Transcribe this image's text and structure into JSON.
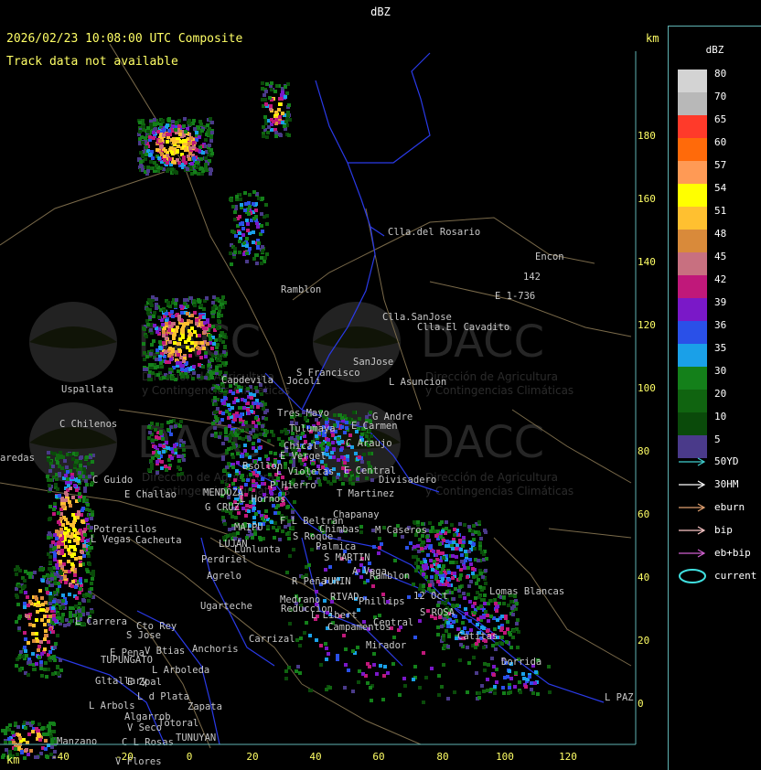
{
  "window": {
    "title": "dBZ"
  },
  "header": {
    "timestamp": "2026/02/23 10:08:00 UTC Composite",
    "track_status": "Track data not available",
    "unit_top_right": "km",
    "unit_bottom_left": "km"
  },
  "axes": {
    "y_ticks": [
      "180",
      "160",
      "140",
      "120",
      "100",
      "80",
      "60",
      "40",
      "20",
      "0"
    ],
    "x_ticks": [
      "-40",
      "-20",
      "0",
      "20",
      "40",
      "60",
      "80",
      "100",
      "120"
    ]
  },
  "watermark": {
    "brand": "DACC",
    "line1": "Dirección de Agricultura",
    "line2": "y Contingencias Climáticas"
  },
  "places": [
    {
      "name": "Clla.del Rosario"
    },
    {
      "name": "Encon"
    },
    {
      "name": "142"
    },
    {
      "name": "E 1-736"
    },
    {
      "name": "Ramblon"
    },
    {
      "name": "Clla.SanJose"
    },
    {
      "name": "Clla.El Cavadito"
    },
    {
      "name": "SanJose"
    },
    {
      "name": "S Francisco"
    },
    {
      "name": "L Asuncion"
    },
    {
      "name": "Uspallata"
    },
    {
      "name": "Capdevila"
    },
    {
      "name": "Jocoli"
    },
    {
      "name": "Tres Mayo"
    },
    {
      "name": "G Andre"
    },
    {
      "name": "E Carmen"
    },
    {
      "name": "C Chilenos"
    },
    {
      "name": "Tulumaya"
    },
    {
      "name": "C Araujo"
    },
    {
      "name": "Chical"
    },
    {
      "name": "E Vergel"
    },
    {
      "name": "L Violetas"
    },
    {
      "name": "E Central"
    },
    {
      "name": "Divisadero"
    },
    {
      "name": "aredas"
    },
    {
      "name": "C Guido"
    },
    {
      "name": "E Challao"
    },
    {
      "name": "Bsollon"
    },
    {
      "name": "P Hierro"
    },
    {
      "name": "MENDOZA"
    },
    {
      "name": "L Hornos"
    },
    {
      "name": "G CRUZ"
    },
    {
      "name": "T Martinez"
    },
    {
      "name": "Chapanay"
    },
    {
      "name": "F L Beltran"
    },
    {
      "name": "Chimbas"
    },
    {
      "name": "M Caseros"
    },
    {
      "name": "Potrerillos"
    },
    {
      "name": "L Vegas"
    },
    {
      "name": "Cacheuta"
    },
    {
      "name": "MAIPU"
    },
    {
      "name": "LUJAN"
    },
    {
      "name": "Lunlunta"
    },
    {
      "name": "S Roque"
    },
    {
      "name": "Palmica"
    },
    {
      "name": "Perdriel"
    },
    {
      "name": "S MARTIN"
    },
    {
      "name": "A Vega"
    },
    {
      "name": "Ramblon"
    },
    {
      "name": "Agrelo"
    },
    {
      "name": "R Peña"
    },
    {
      "name": "JUNIN"
    },
    {
      "name": "Lomas Blancas"
    },
    {
      "name": "Ugarteche"
    },
    {
      "name": "Medrano"
    },
    {
      "name": "RIVAD"
    },
    {
      "name": "Phillips"
    },
    {
      "name": "12 Oct"
    },
    {
      "name": "Reduccion"
    },
    {
      "name": "L Libert"
    },
    {
      "name": "S ROSA"
    },
    {
      "name": "L Carrera"
    },
    {
      "name": "Cto Rey"
    },
    {
      "name": "S Jose"
    },
    {
      "name": "Campamentos"
    },
    {
      "name": "Central"
    },
    {
      "name": "Catitas"
    },
    {
      "name": "Carrizal"
    },
    {
      "name": "E Pena"
    },
    {
      "name": "V Btias"
    },
    {
      "name": "Anchoris"
    },
    {
      "name": "Mirador"
    },
    {
      "name": "Dorrida"
    },
    {
      "name": "TUPUNGATO"
    },
    {
      "name": "L Arboleda"
    },
    {
      "name": "Gltallary"
    },
    {
      "name": "E Zpal"
    },
    {
      "name": "L d Plata"
    },
    {
      "name": "L Arbols"
    },
    {
      "name": "Zapata"
    },
    {
      "name": "L PAZ"
    },
    {
      "name": "Algarrob"
    },
    {
      "name": "V Seco"
    },
    {
      "name": "Totoral"
    },
    {
      "name": "TUNUYAN"
    },
    {
      "name": "Manzano"
    },
    {
      "name": "C L Rosas"
    },
    {
      "name": "V Flores"
    }
  ],
  "legend": {
    "title": "dBZ",
    "scale": [
      {
        "value": "80",
        "color": "#d3d3d3"
      },
      {
        "value": "70",
        "color": "#b8b8b8"
      },
      {
        "value": "65",
        "color": "#ff3a2a"
      },
      {
        "value": "60",
        "color": "#ff6a0a"
      },
      {
        "value": "57",
        "color": "#ff9a55"
      },
      {
        "value": "54",
        "color": "#ffff00"
      },
      {
        "value": "51",
        "color": "#ffc030"
      },
      {
        "value": "48",
        "color": "#d98a3a"
      },
      {
        "value": "45",
        "color": "#c87080"
      },
      {
        "value": "42",
        "color": "#c0187a"
      },
      {
        "value": "39",
        "color": "#7a18c8"
      },
      {
        "value": "36",
        "color": "#2a50e8"
      },
      {
        "value": "35",
        "color": "#1aa0e8"
      },
      {
        "value": "30",
        "color": "#14801a"
      },
      {
        "value": "20",
        "color": "#106410"
      },
      {
        "value": "10",
        "color": "#0a4a0a"
      },
      {
        "value": "5",
        "color": "#4a3a8a"
      }
    ],
    "tracks": [
      {
        "label": "50YD",
        "color": "#40d0d0",
        "kind": "arrow"
      },
      {
        "label": "30HM",
        "color": "#ffffff",
        "kind": "arrow"
      },
      {
        "label": "eburn",
        "color": "#e0a070",
        "kind": "arrow"
      },
      {
        "label": "bip",
        "color": "#ffc8c8",
        "kind": "arrow"
      },
      {
        "label": "eb+bip",
        "color": "#d060d0",
        "kind": "arrow"
      },
      {
        "label": "current",
        "color": "#40e0e0",
        "kind": "ellipse"
      }
    ]
  }
}
